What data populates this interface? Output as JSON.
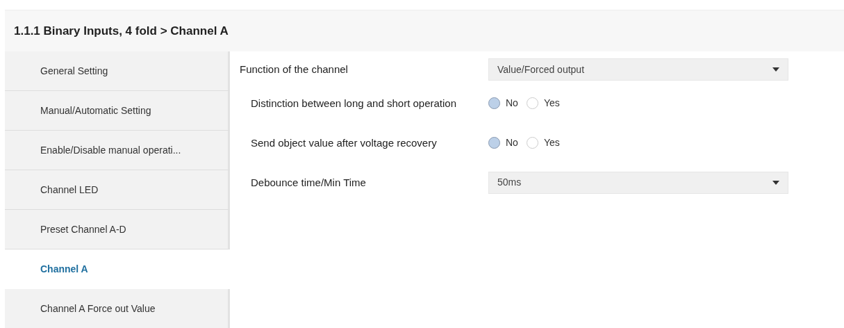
{
  "header": {
    "title": "1.1.1 Binary Inputs, 4 fold > Channel A"
  },
  "sidebar": {
    "items": [
      {
        "label": "General Setting",
        "selected": false
      },
      {
        "label": "Manual/Automatic Setting",
        "selected": false
      },
      {
        "label": "Enable/Disable manual operati...",
        "selected": false
      },
      {
        "label": "Channel LED",
        "selected": false
      },
      {
        "label": "Preset Channel A-D",
        "selected": false
      },
      {
        "label": "Channel A",
        "selected": true
      },
      {
        "label": "Channel A Force out Value",
        "selected": false
      }
    ]
  },
  "parameters": [
    {
      "kind": "dropdown",
      "label": "Function of the channel",
      "value": "Value/Forced output",
      "children": [
        {
          "kind": "radio",
          "label": "Distinction between long and short operation",
          "options": [
            {
              "label": "No",
              "selected": true
            },
            {
              "label": "Yes",
              "selected": false
            }
          ]
        },
        {
          "kind": "radio",
          "label": "Send object value after voltage recovery",
          "options": [
            {
              "label": "No",
              "selected": true
            },
            {
              "label": "Yes",
              "selected": false
            }
          ]
        },
        {
          "kind": "dropdown",
          "label": "Debounce time/Min Time",
          "value": "50ms"
        }
      ]
    }
  ]
}
